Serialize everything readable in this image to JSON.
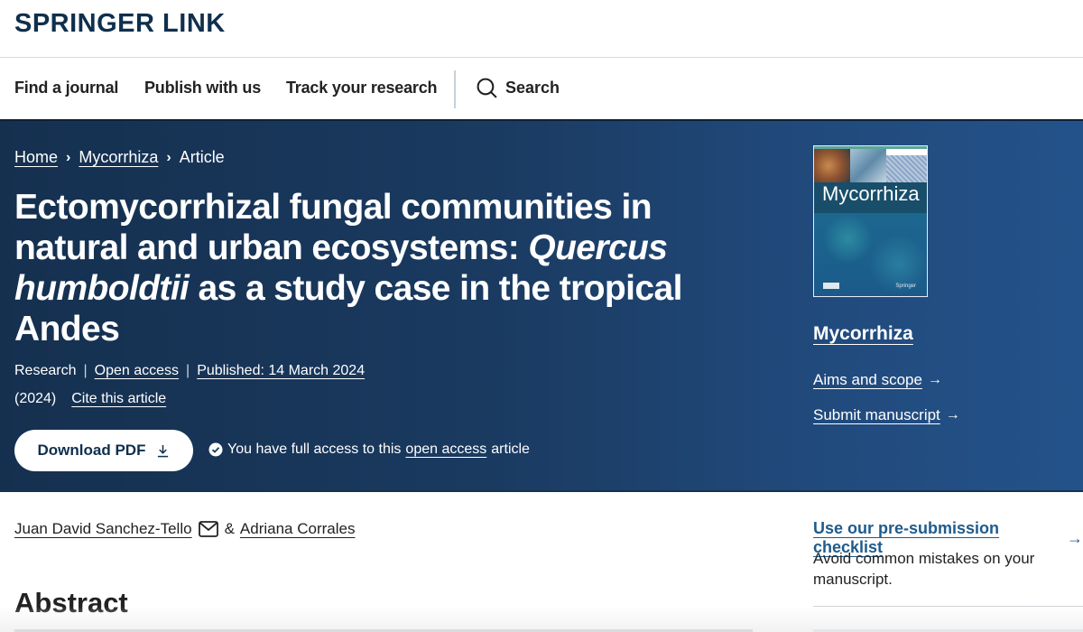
{
  "brand": {
    "name_part1": "SPRINGER",
    "name_part2": "LINK"
  },
  "nav": {
    "items": [
      {
        "label": "Find a journal"
      },
      {
        "label": "Publish with us"
      },
      {
        "label": "Track your research"
      }
    ],
    "search_label": "Search"
  },
  "breadcrumb": {
    "items": [
      "Home",
      "Mycorrhiza",
      "Article"
    ]
  },
  "article": {
    "title_part1": "Ectomycorrhizal fungal communities in natural and urban ecosystems: ",
    "title_italic1": "Quercus humboldtii",
    "title_part2": " as a study case in the tropical Andes",
    "type": "Research",
    "access": "Open access",
    "published": "Published: 14 March 2024",
    "year": "(2024)",
    "cite_label": "Cite this article",
    "download_label": "Download PDF",
    "access_note_prefix": "You have full access to this",
    "access_note_link": "open access",
    "access_note_suffix": "article",
    "authors": [
      {
        "name": "Juan David Sanchez-Tello"
      },
      {
        "name": "Adriana Corrales"
      }
    ],
    "author_separator": "&",
    "abstract_heading": "Abstract"
  },
  "journal": {
    "cover_title": "Mycorrhiza",
    "cover_publisher": "Springer",
    "name": "Mycorrhiza",
    "links": [
      {
        "label": "Aims and scope",
        "icon": "arrow-right-icon"
      },
      {
        "label": "Submit manuscript",
        "icon": "arrow-right-icon"
      }
    ]
  },
  "sidebar": {
    "checklist_label": "Use our pre-submission checklist",
    "checklist_desc": "Avoid common mistakes on your manuscript."
  },
  "colors": {
    "brand_navy": "#0f2f4d",
    "hero_left": "#15304f",
    "hero_right": "#23528a",
    "link_blue": "#1f5b8c"
  }
}
